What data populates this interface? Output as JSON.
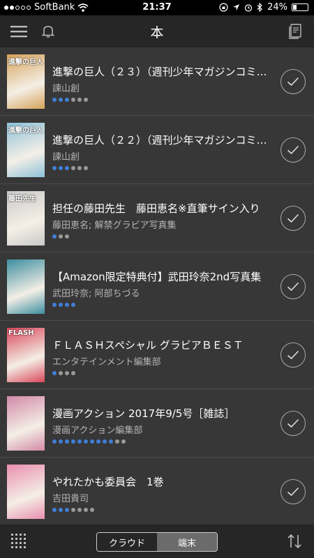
{
  "status_bar": {
    "carrier": "SoftBank",
    "time": "21:37",
    "battery": "24%",
    "battery_level": 0.24
  },
  "header": {
    "title": "本"
  },
  "books": [
    {
      "title": "進撃の巨人（２３）（週刊少年マガジンコミックス）",
      "author": "諫山創",
      "cover_text": "進撃の巨人",
      "cover_color": "#d5a25a",
      "progress_read": 3,
      "progress_total": 6
    },
    {
      "title": "進撃の巨人（２２）（週刊少年マガジンコミックス）",
      "author": "諫山創",
      "cover_text": "進撃の巨人",
      "cover_color": "#8ec1da",
      "progress_read": 3,
      "progress_total": 6
    },
    {
      "title": "担任の藤田先生　藤田恵名※直筆サイン入り",
      "author": "藤田恵名; 解禁グラビア写真集",
      "cover_text": "藤田先生",
      "cover_color": "#c9c9c9",
      "progress_read": 1,
      "progress_total": 3
    },
    {
      "title": "【Amazon限定特典付】武田玲奈2nd写真集",
      "author": "武田玲奈; 阿部ちづる",
      "cover_text": "",
      "cover_color": "#3d8ea0",
      "progress_read": 4,
      "progress_total": 4
    },
    {
      "title": "ＦＬＡＳＨスペシャル グラビアＢＥＳＴ",
      "author": "エンタテインメント編集部",
      "cover_text": "FLASH",
      "cover_color": "#d9475a",
      "progress_read": 1,
      "progress_total": 4
    },
    {
      "title": "漫画アクション 2017年9/5号［雑誌］",
      "author": "漫画アクション編集部",
      "cover_text": "",
      "cover_color": "#d28aa8",
      "progress_read": 10,
      "progress_total": 12
    },
    {
      "title": "やれたかも委員会　1巻",
      "author": "吉田貴司",
      "cover_text": "",
      "cover_color": "#ea8fb0",
      "progress_read": 3,
      "progress_total": 7
    }
  ],
  "bottom_bar": {
    "segment_cloud": "クラウド",
    "segment_device": "端末",
    "selected": "端末"
  },
  "colors": {
    "accent": "#3f7fd6",
    "list_bg": "#373737",
    "bar_bg": "#262626"
  }
}
